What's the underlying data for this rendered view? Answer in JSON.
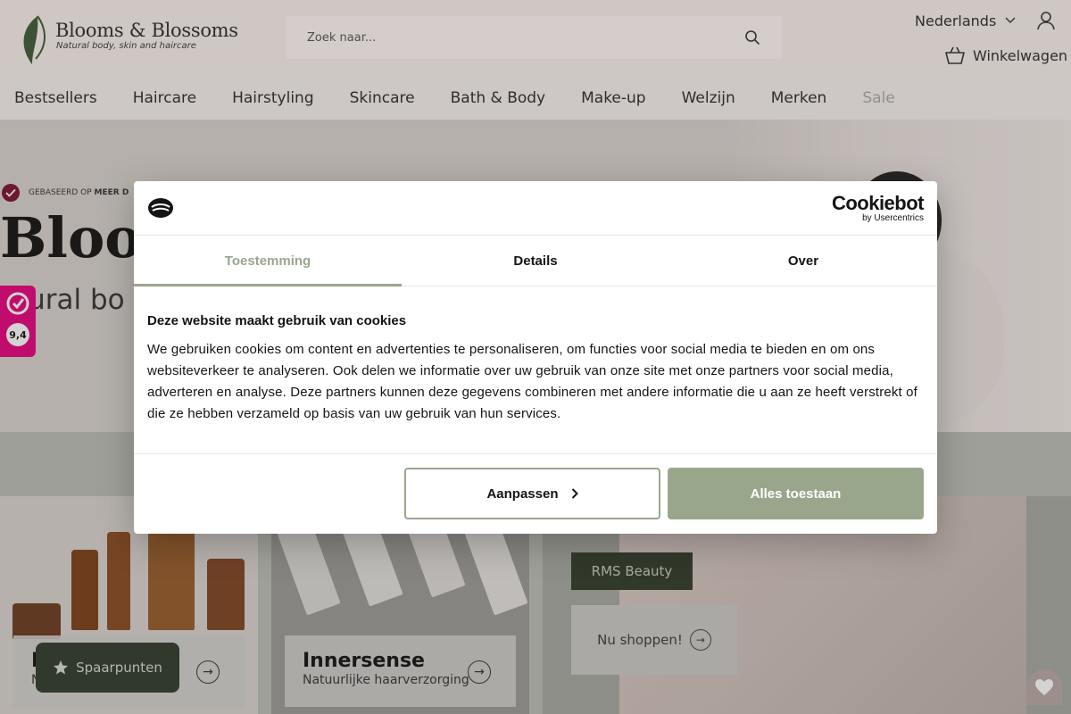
{
  "header": {
    "logo_title": "Blooms & Blossoms",
    "logo_subtitle": "Natural body, skin and haircare",
    "search_placeholder": "Zoek naar...",
    "language": "Nederlands",
    "cart_label": "Winkelwagen"
  },
  "nav": {
    "items": [
      "Bestsellers",
      "Haircare",
      "Hairstyling",
      "Skincare",
      "Bath & Body",
      "Make-up",
      "Welzijn",
      "Merken",
      "Sale"
    ]
  },
  "hero": {
    "badge_prefix": "GEBASEERD OP ",
    "badge_bold": "MEER D",
    "title": "Bloo",
    "subtitle": "atural bo"
  },
  "kiyoh": {
    "score": "9,4"
  },
  "tiles": [
    {
      "title": "N",
      "subtitle": "N"
    },
    {
      "title": "Innersense",
      "subtitle": "Natuurlijke haarverzorging"
    }
  ],
  "promo": {
    "tag": "RMS Beauty",
    "cta": "Nu shoppen!"
  },
  "spaarpunten": {
    "label": "Spaarpunten"
  },
  "cookie_dialog": {
    "brand": "Cookiebot",
    "brand_by": "by Usercentrics",
    "tabs": [
      "Toestemming",
      "Details",
      "Over"
    ],
    "active_tab": "Toestemming",
    "heading": "Deze website maakt gebruik van cookies",
    "body": "We gebruiken cookies om content en advertenties te personaliseren, om functies voor social media te bieden en om ons websiteverkeer te analyseren. Ook delen we informatie over uw gebruik van onze site met onze partners voor social media, adverteren en analyse. Deze partners kunnen deze gegevens combineren met andere informatie die u aan ze heeft verstrekt of die ze hebben verzameld op basis van uw gebruik van hun services.",
    "customize_label": "Aanpassen",
    "allow_all_label": "Alles toestaan"
  },
  "colors": {
    "accent_sage": "#9aa68c",
    "dark_green": "#2e3a29",
    "kiyoh_pink": "#e6007e",
    "header_bg": "#f9f0ee"
  },
  "icons": [
    "leaf-logo-icon",
    "search-icon",
    "chevron-down-icon",
    "user-icon",
    "basket-icon",
    "check-icon",
    "kiyoh-icon",
    "arrow-right-icon",
    "star-icon",
    "heart-icon",
    "cookie-icon",
    "chevron-right-icon"
  ]
}
